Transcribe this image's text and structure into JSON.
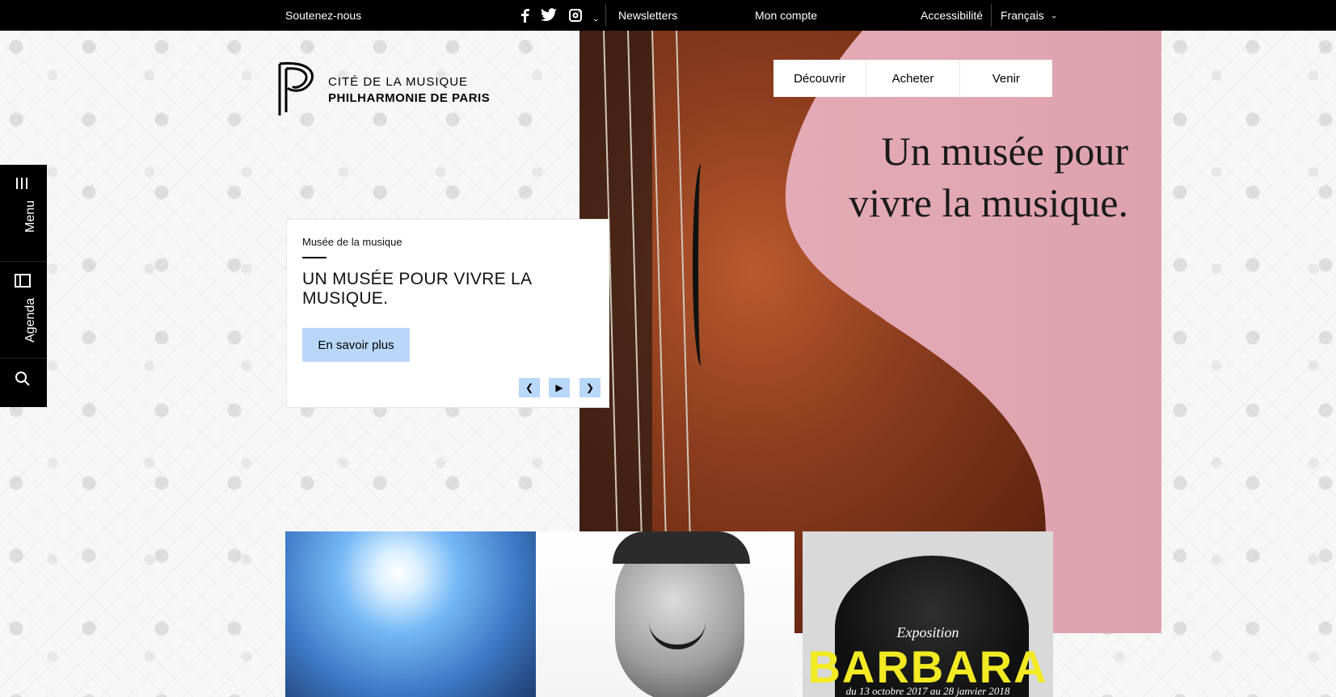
{
  "topbar": {
    "support": "Soutenez-nous",
    "newsletters": "Newsletters",
    "account": "Mon compte",
    "accessibility": "Accessibilité",
    "language": "Français",
    "social": [
      "facebook-icon",
      "twitter-icon",
      "instagram-icon"
    ]
  },
  "logo": {
    "line1": "CITÉ DE LA MUSIQUE",
    "line2": "PHILHARMONIE DE PARIS"
  },
  "sidebar": {
    "items": [
      {
        "label": "Menu",
        "icon": "menu-icon"
      },
      {
        "label": "Agenda",
        "icon": "agenda-icon"
      },
      {
        "label": "",
        "icon": "search-icon"
      }
    ]
  },
  "hero": {
    "nav": [
      "Découvrir",
      "Acheter",
      "Venir"
    ],
    "title": "Un musée pour vivre la musique."
  },
  "card": {
    "kicker": "Musée de la musique",
    "title": "UN MUSÉE POUR VIVRE LA MUSIQUE.",
    "cta": "En savoir plus"
  },
  "tiles": {
    "barbara": {
      "exposition": "Exposition",
      "title": "BARBARA",
      "dates": "du 13 octobre 2017 au 28 janvier 2018"
    }
  },
  "colors": {
    "accent": "#b9d7f9",
    "hero_pink": "#e1a7b2",
    "topbar": "#000000"
  }
}
